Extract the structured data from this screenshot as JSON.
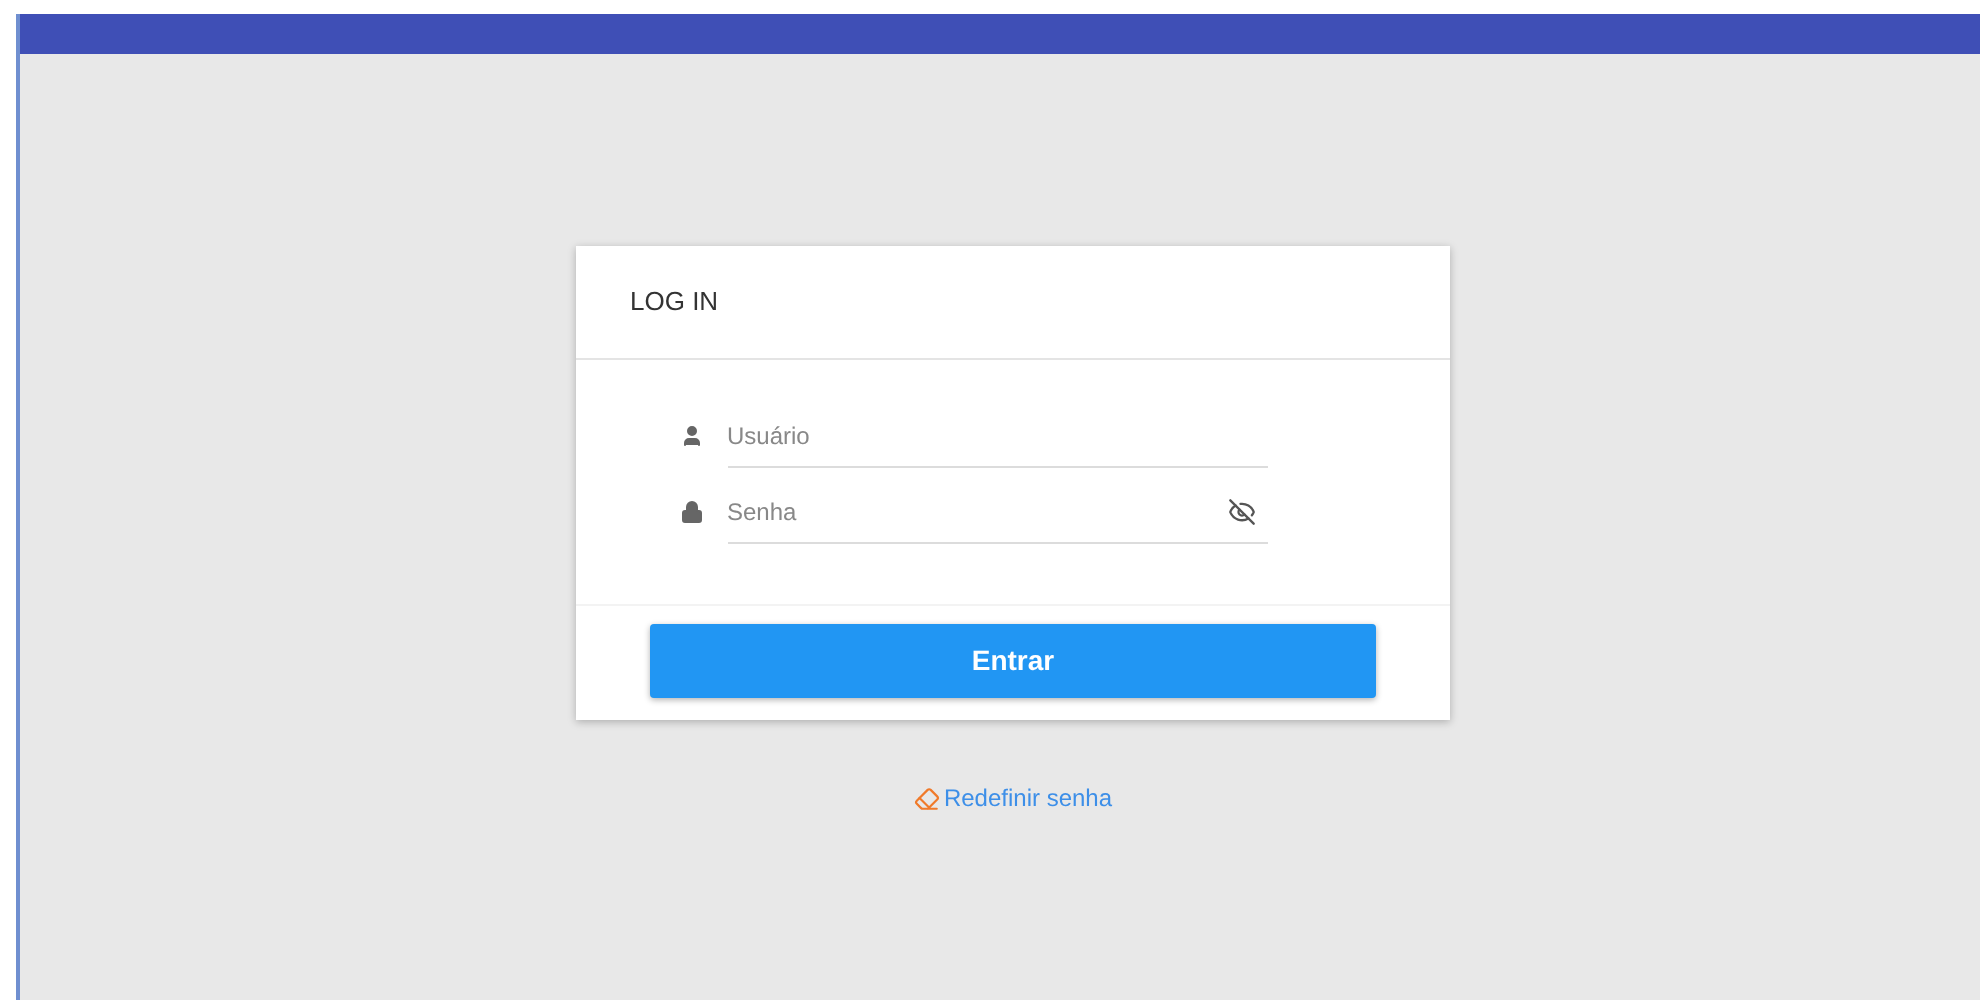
{
  "card": {
    "title": "LOG IN"
  },
  "fields": [
    {
      "kind": "user",
      "placeholder": "Usuário"
    },
    {
      "kind": "password",
      "placeholder": "Senha"
    }
  ],
  "submit": "Entrar",
  "reset_link": "Redefinir senha"
}
